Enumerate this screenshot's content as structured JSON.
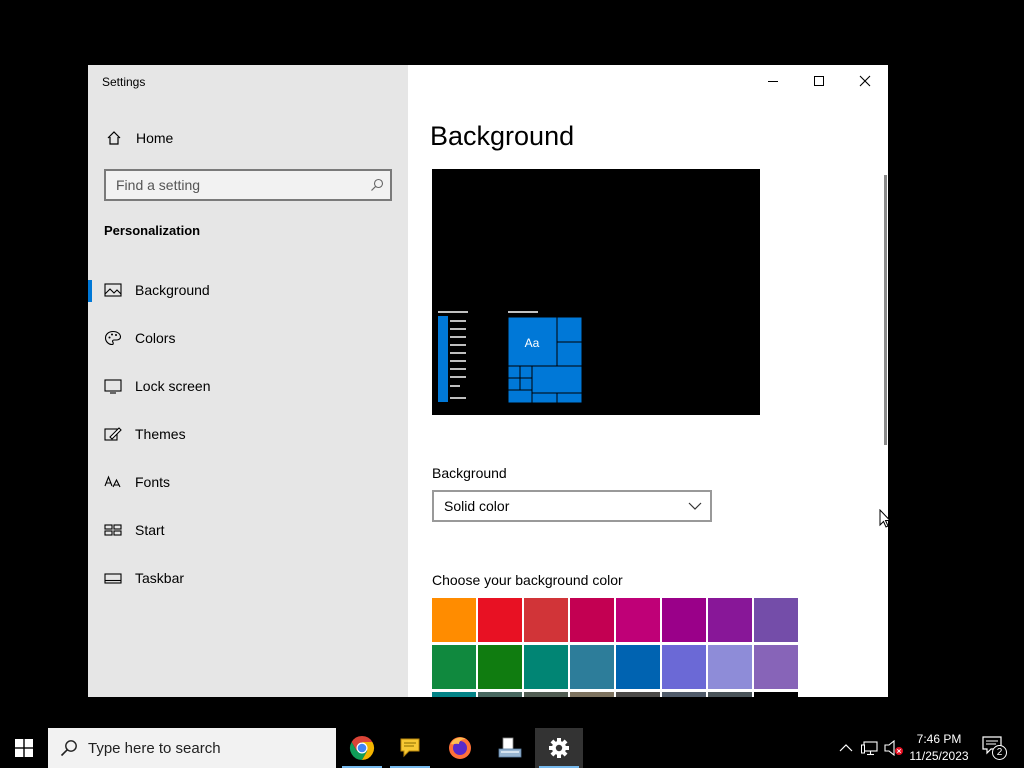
{
  "window": {
    "title": "Settings"
  },
  "sidebar": {
    "home_label": "Home",
    "search_placeholder": "Find a setting",
    "section_title": "Personalization",
    "items": [
      {
        "label": "Background",
        "icon": "picture-icon",
        "selected": true
      },
      {
        "label": "Colors",
        "icon": "palette-icon",
        "selected": false
      },
      {
        "label": "Lock screen",
        "icon": "lock-screen-icon",
        "selected": false
      },
      {
        "label": "Themes",
        "icon": "themes-icon",
        "selected": false
      },
      {
        "label": "Fonts",
        "icon": "fonts-icon",
        "selected": false
      },
      {
        "label": "Start",
        "icon": "start-icon",
        "selected": false
      },
      {
        "label": "Taskbar",
        "icon": "taskbar-icon",
        "selected": false
      }
    ]
  },
  "main": {
    "page_title": "Background",
    "preview": {
      "sample_text": "Aa",
      "background_color": "#000000",
      "accent_color": "#0078d7"
    },
    "background_label": "Background",
    "background_value": "Solid color",
    "color_label": "Choose your background color",
    "swatch_rows": [
      [
        "#ff8c00",
        "#e81123",
        "#d13438",
        "#c30052",
        "#bf0077",
        "#9a0089",
        "#881798",
        "#744da9"
      ],
      [
        "#10893e",
        "#107c10",
        "#018574",
        "#2d7d9a",
        "#0063b1",
        "#6b69d6",
        "#8e8cd8",
        "#8764b8"
      ],
      [
        "#038387",
        "#486860",
        "#525e54",
        "#7e735f",
        "#4c4a48",
        "#515c6b",
        "#4a5459",
        "#000000"
      ]
    ]
  },
  "taskbar": {
    "search_placeholder": "Type here to search",
    "apps": [
      {
        "name": "chrome-icon",
        "active": false
      },
      {
        "name": "chat-icon",
        "active": false
      },
      {
        "name": "firefox-icon",
        "active": false
      },
      {
        "name": "files-icon",
        "active": false
      },
      {
        "name": "settings-gear-icon",
        "active": true
      }
    ],
    "time": "7:46 PM",
    "date": "11/25/2023",
    "notification_count": "2"
  }
}
